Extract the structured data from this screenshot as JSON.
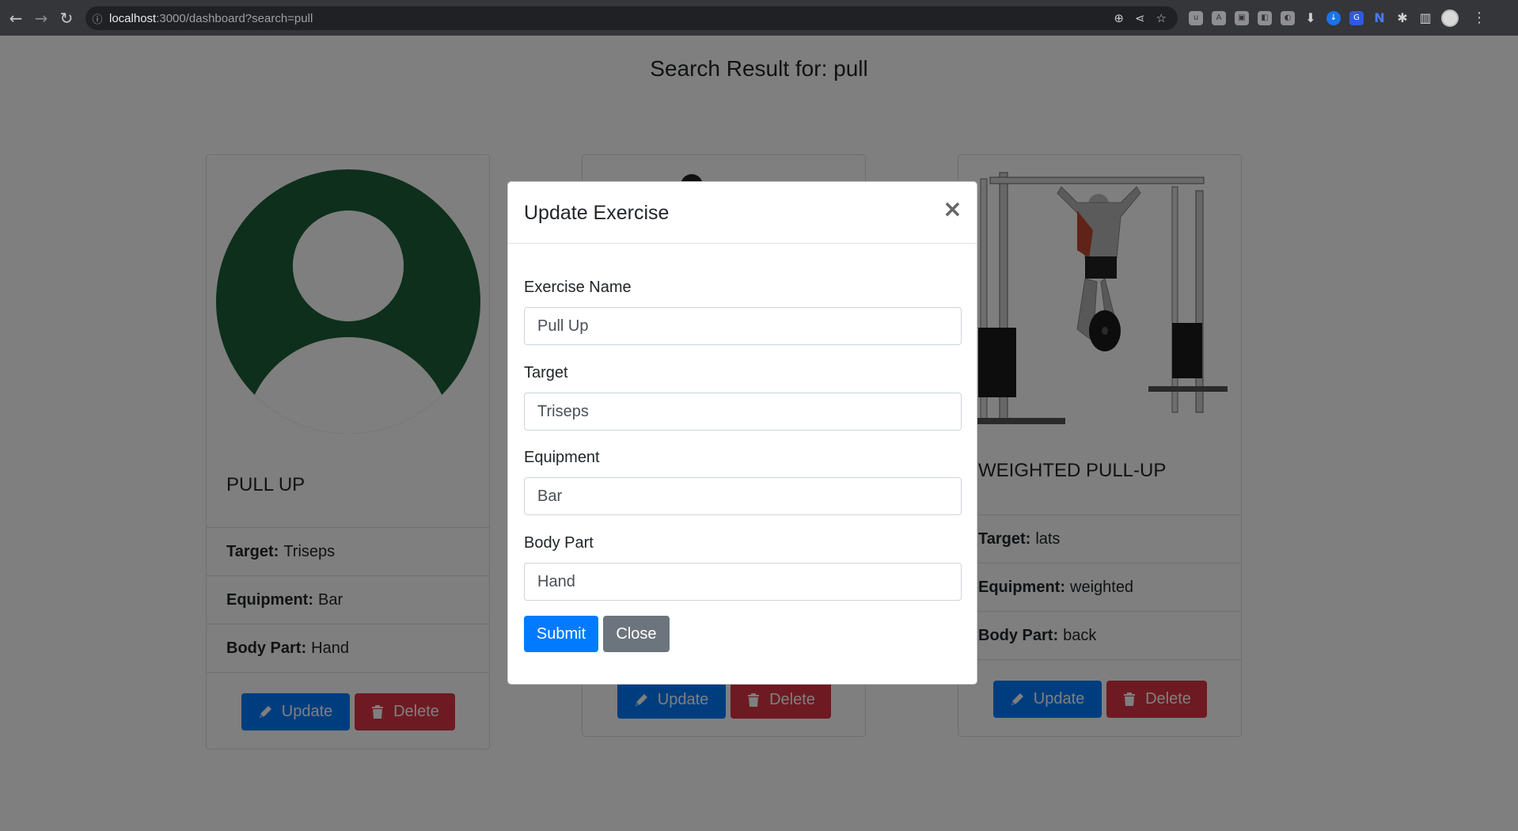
{
  "browser": {
    "url_host": "localhost",
    "url_path": ":3000/dashboard?search=pull",
    "back_icon": "arrow-left-icon",
    "forward_icon": "arrow-right-icon",
    "reload_icon": "reload-icon"
  },
  "page": {
    "title": "Search Result for: pull"
  },
  "cards": [
    {
      "title": "PULL UP",
      "target_label": "Target:",
      "target": "Triseps",
      "equipment_label": "Equipment:",
      "equipment": "Bar",
      "body_part_label": "Body Part:",
      "body_part": "Hand",
      "update_label": "Update",
      "delete_label": "Delete",
      "image": "default-avatar-icon",
      "avatar_color": "#1a5e38"
    },
    {
      "title": "",
      "update_label": "Update",
      "delete_label": "Delete",
      "image": "exercise-figure"
    },
    {
      "title": "WEIGHTED PULL-UP",
      "target_label": "Target:",
      "target": "lats",
      "equipment_label": "Equipment:",
      "equipment": "weighted",
      "body_part_label": "Body Part:",
      "body_part": "back",
      "update_label": "Update",
      "delete_label": "Delete",
      "image": "weighted-pull-up-machine"
    }
  ],
  "modal": {
    "title": "Update Exercise",
    "close_symbol": "×",
    "fields": [
      {
        "label": "Exercise Name",
        "value": "Pull Up"
      },
      {
        "label": "Target",
        "value": "Triseps"
      },
      {
        "label": "Equipment",
        "value": "Bar"
      },
      {
        "label": "Body Part",
        "value": "Hand"
      }
    ],
    "submit_label": "Submit",
    "close_label": "Close"
  },
  "colors": {
    "primary": "#007bff",
    "danger": "#dc3545",
    "secondary": "#6c757d"
  }
}
